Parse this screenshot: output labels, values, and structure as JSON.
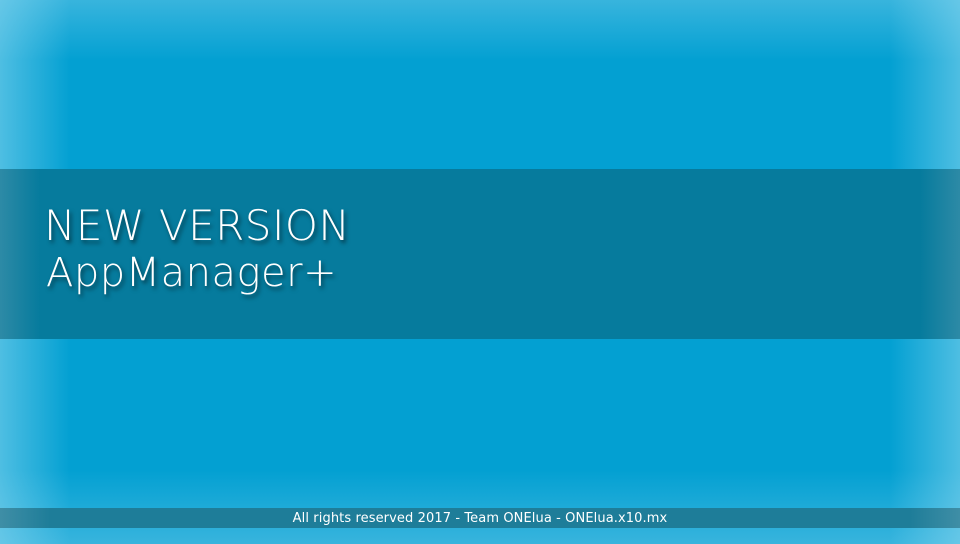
{
  "banner": {
    "headline": "NEW VERSION",
    "app_name": "AppManager+"
  },
  "footer": {
    "text": "All rights reserved 2017 - Team ONElua - ONElua.x10.mx"
  },
  "colors": {
    "background": "#03a0d2",
    "banner": "#067b9d",
    "footer_bar": "#1e7d99",
    "text": "#ffffff"
  }
}
